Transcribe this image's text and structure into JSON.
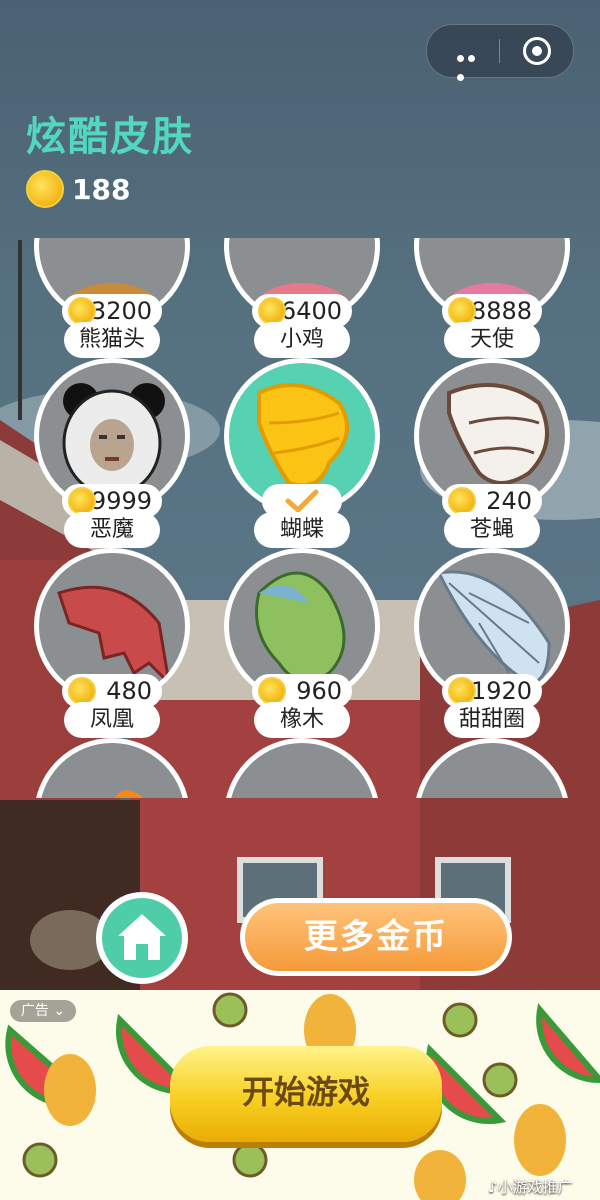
{
  "header": {
    "title": "炫酷皮肤",
    "coins": "188"
  },
  "capsule": {
    "more_icon": "more-dots-icon",
    "close_icon": "target-icon"
  },
  "skins": [
    {
      "label": "",
      "price": "3200",
      "state": "locked"
    },
    {
      "label": "",
      "price": "6400",
      "state": "locked"
    },
    {
      "label": "",
      "price": "8888",
      "state": "locked"
    },
    {
      "label": "熊猫头",
      "price": "9999",
      "state": "locked"
    },
    {
      "label": "小鸡",
      "price": "",
      "state": "selected"
    },
    {
      "label": "天使",
      "price": "240",
      "state": "locked"
    },
    {
      "label": "恶魔",
      "price": "480",
      "state": "locked"
    },
    {
      "label": "蝴蝶",
      "price": "960",
      "state": "locked"
    },
    {
      "label": "苍蝇",
      "price": "1920",
      "state": "locked"
    },
    {
      "label": "凤凰",
      "price": "",
      "state": "locked"
    },
    {
      "label": "橡木",
      "price": "",
      "state": "locked"
    },
    {
      "label": "甜甜圈",
      "price": "",
      "state": "locked"
    }
  ],
  "buttons": {
    "more_coins": "更多金币",
    "home_icon": "home-icon"
  },
  "ad": {
    "tag": "广告 ⌄",
    "start": "开始游戏",
    "promo": "♪小游戏推广"
  },
  "colors": {
    "title": "#53d8c0",
    "selected_disc": "#56d1b2",
    "disc": "#8c8f92",
    "more_button": "#f59a3a",
    "start_button": "#f8cf22"
  }
}
